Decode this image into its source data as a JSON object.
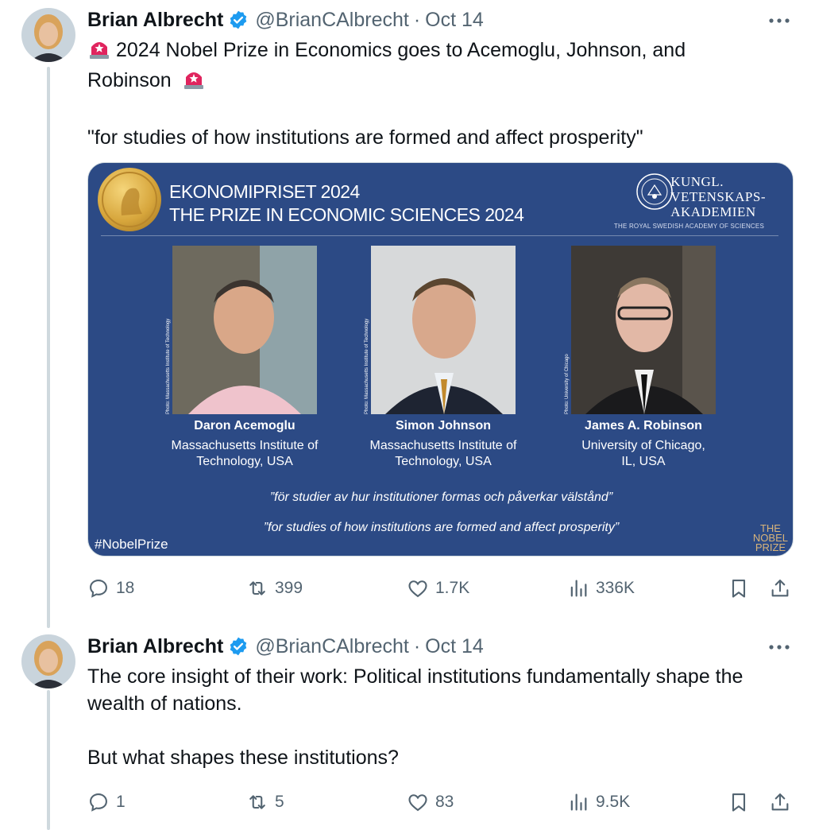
{
  "thread": [
    {
      "author": {
        "name": "Brian Albrecht",
        "handle": "@BrianCAlbrecht",
        "date": "Oct 14"
      },
      "text_line1": "2024 Nobel Prize in Economics goes to Acemoglu, Johnson, and",
      "text_line2": "Robinson",
      "text_line3": "\"for studies of how institutions are formed and affect prosperity\"",
      "media": {
        "title_line1": "EKONOMIPRISET 2024",
        "title_line2": "THE PRIZE IN ECONOMIC SCIENCES 2024",
        "academy_line1": "KUNGL.",
        "academy_line2": "VETENSKAPS-",
        "academy_line3": "AKADEMIEN",
        "academy_subtitle": "THE ROYAL SWEDISH ACADEMY OF SCIENCES",
        "laureates": [
          {
            "name": "Daron Acemoglu",
            "inst1": "Massachusetts Institute of",
            "inst2": "Technology, USA",
            "credit": "Photo: Massachusetts Institute of Technology"
          },
          {
            "name": "Simon Johnson",
            "inst1": "Massachusetts Institute of",
            "inst2": "Technology, USA",
            "credit": "Photo: Massachusetts Institute of Technology"
          },
          {
            "name": "James A. Robinson",
            "inst1": "University of Chicago,",
            "inst2": "IL, USA",
            "credit": "Photo: University of Chicago"
          }
        ],
        "quote_sv": "”för studier av hur institutioner formas och påverkar välstånd”",
        "quote_en": "”for studies of how institutions are formed and affect prosperity”",
        "hashtag": "#NobelPrize",
        "brand_line1": "THE",
        "brand_line2": "NOBEL",
        "brand_line3": "PRIZE"
      },
      "stats": {
        "replies": "18",
        "reposts": "399",
        "likes": "1.7K",
        "views": "336K"
      }
    },
    {
      "author": {
        "name": "Brian Albrecht",
        "handle": "@BrianCAlbrecht",
        "date": "Oct 14"
      },
      "text_line1": "The core insight of their work: Political institutions fundamentally shape the",
      "text_line2": "wealth of nations.",
      "text_line3": "But what shapes these institutions?",
      "stats": {
        "replies": "1",
        "reposts": "5",
        "likes": "83",
        "views": "9.5K"
      }
    }
  ],
  "colors": {
    "verified": "#1d9bf0",
    "muted": "#536471",
    "card_bg": "#2c4a85",
    "siren": "#e0245e"
  },
  "icons": [
    "verified-badge-icon",
    "more-icon",
    "siren-emoji-icon",
    "reply-icon",
    "repost-icon",
    "like-icon",
    "views-icon",
    "bookmark-icon",
    "share-icon"
  ]
}
